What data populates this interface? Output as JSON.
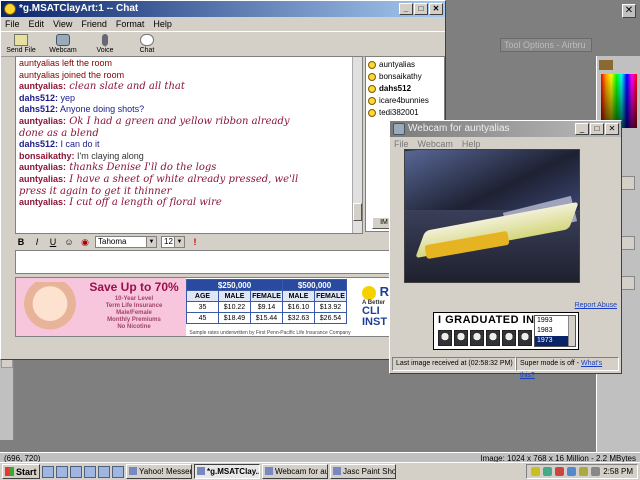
{
  "chat_window": {
    "title": "*g.MSATClayArt:1 -- Chat",
    "menu": [
      "File",
      "Edit",
      "View",
      "Friend",
      "Format",
      "Help"
    ],
    "toolbar": [
      {
        "label": "Send File",
        "icon": "send-file-icon"
      },
      {
        "label": "Webcam",
        "icon": "webcam-icon"
      },
      {
        "label": "Voice",
        "icon": "microphone-icon"
      },
      {
        "label": "Chat",
        "icon": "chat-icon"
      }
    ],
    "messages": [
      {
        "user": "auntyalias",
        "text": " left the room",
        "kind": "system"
      },
      {
        "user": "auntyalias",
        "text": " joined the room",
        "kind": "system"
      },
      {
        "user": "auntyalias:",
        "text": " clean slate and all that",
        "kind": "script"
      },
      {
        "user": "dahs512:",
        "text": " yep",
        "kind": "plain"
      },
      {
        "user": "dahs512:",
        "text": " Anyone doing shots?",
        "kind": "plain"
      },
      {
        "user": "auntyalias:",
        "text": " Ok I had a green and yellow ribbon already",
        "kind": "script"
      },
      {
        "user": "",
        "text": "  done as a blend",
        "kind": "script"
      },
      {
        "user": "dahs512:",
        "text": " I can do it",
        "kind": "plain"
      },
      {
        "user": "bonsaikathy:",
        "text": " I'm claying along",
        "kind": "plainb"
      },
      {
        "user": "auntyalias:",
        "text": " thanks Denise I'll do the logs",
        "kind": "script"
      },
      {
        "user": "auntyalias:",
        "text": " I have a sheet of white already pressed, we'll",
        "kind": "script"
      },
      {
        "user": "",
        "text": "  press it again to get it thinner",
        "kind": "script"
      },
      {
        "user": "auntyalias:",
        "text": " I cut off a length of floral wire",
        "kind": "script"
      }
    ],
    "users": [
      "auntyalias",
      "bonsaikathy",
      "dahs512",
      "icare4bunnies",
      "tedi382001"
    ],
    "im_button": "IM",
    "format": {
      "bold": "B",
      "italic": "I",
      "underline": "U",
      "font": "Tahoma",
      "size": "12"
    },
    "ad": {
      "headline": "Save Up to 70%",
      "sub": "10-Year Level\nTerm Life Insurance\nMale/Female\nMonthly Premiums\nNo Nicotine",
      "amounts": [
        "$250,000",
        "$500,000"
      ],
      "cols": [
        "AGE",
        "MALE",
        "FEMALE",
        "MALE",
        "FEMALE"
      ],
      "rows": [
        [
          "35",
          "$10.22",
          "$9.14",
          "$16.10",
          "$13.92"
        ],
        [
          "45",
          "$18.49",
          "$15.44",
          "$32.63",
          "$26.54"
        ]
      ],
      "fine": "Sample rates underwritten by First Penn-Pacific Life Insurance Company",
      "brand": "Re",
      "brand_tag": "A Better",
      "cta1": "CLI",
      "cta2": "INST"
    }
  },
  "webcam_window": {
    "title": "Webcam for auntyalias",
    "menu": [
      "File",
      "Webcam",
      "Help"
    ],
    "report_abuse": "Report Abuse",
    "grad_ad": {
      "title": "I GRADUATED IN:",
      "years": [
        "1993",
        "1983",
        "1973"
      ],
      "selected": "1973"
    },
    "status_left": "Last image received at (02:58:32 PM)",
    "status_right": "Super mode is off - ",
    "whats_this": "What's this?"
  },
  "psp": {
    "tool_options": "Tool Options - Airbru",
    "coords": "(696, 720)",
    "image_info": "Image:  1024 x 768 x 16 Million - 2.2 MBytes"
  },
  "taskbar": {
    "start": "Start",
    "buttons": [
      {
        "label": "Yahoo! Messen...",
        "active": false
      },
      {
        "label": "*g.MSATClay...",
        "active": true
      },
      {
        "label": "Webcam for au...",
        "active": false
      },
      {
        "label": "Jasc Paint Shop...",
        "active": false
      }
    ],
    "time": "2:58 PM"
  },
  "colors": {
    "active_title": "#0a246a",
    "aunty": "#8a1538",
    "dahs": "#1b1b8a",
    "link": "#1a3fbf"
  }
}
